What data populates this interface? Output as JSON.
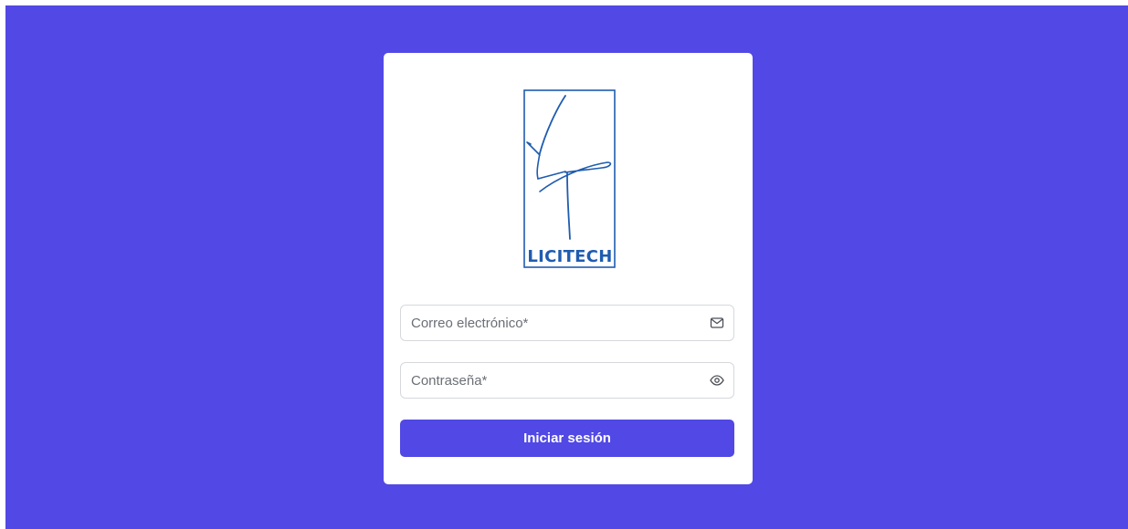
{
  "brand": {
    "name": "LICITECH",
    "logo_icon": "licitech-signature-logo",
    "color": "#1f5cb0"
  },
  "form": {
    "email": {
      "placeholder": "Correo electrónico*",
      "value": "",
      "icon": "mail-icon"
    },
    "password": {
      "placeholder": "Contraseña*",
      "value": "",
      "icon": "eye-icon"
    },
    "submit_label": "Iniciar sesión"
  },
  "colors": {
    "background": "#5148e5",
    "card": "#ffffff",
    "button": "#5148e5",
    "button_text": "#ffffff"
  }
}
